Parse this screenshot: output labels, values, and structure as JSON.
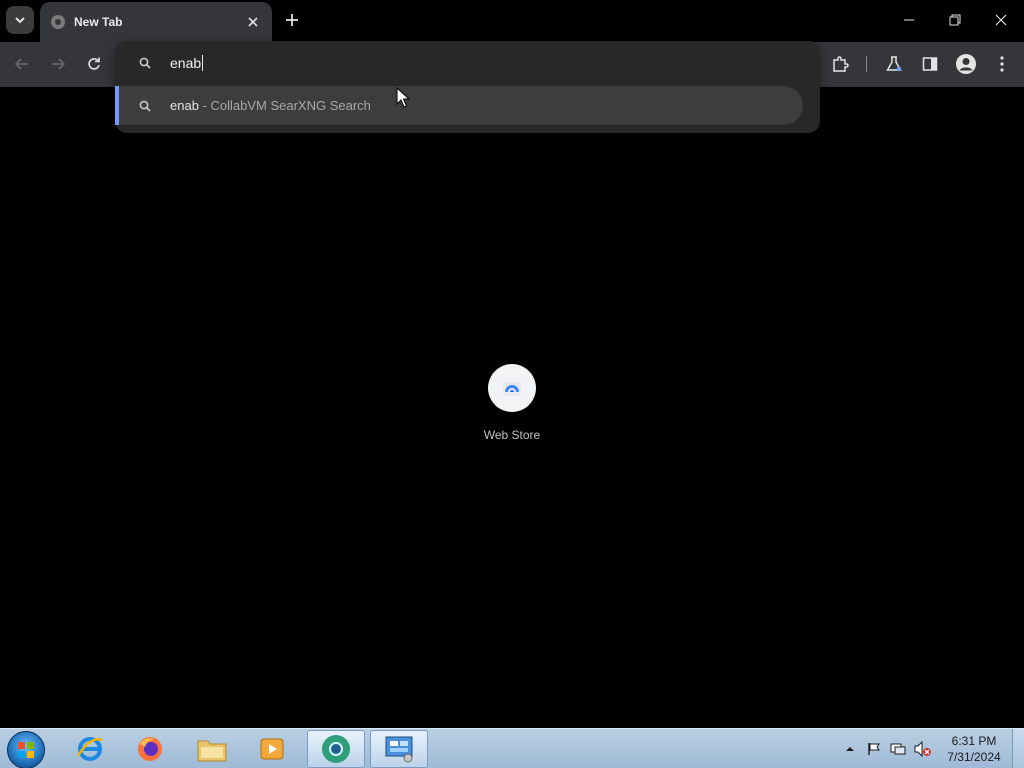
{
  "browser": {
    "tab": {
      "title": "New Tab"
    },
    "omnibox": {
      "input_value": "enab",
      "suggestion": {
        "query": "enab",
        "description": "- CollabVM SearXNG Search"
      }
    }
  },
  "page": {
    "shortcuts": [
      {
        "label": "Web Store"
      }
    ]
  },
  "taskbar": {
    "clock": {
      "time": "6:31 PM",
      "date": "7/31/2024"
    },
    "apps": [
      "internet-explorer",
      "firefox",
      "file-explorer",
      "media-player",
      "chrome",
      "control-panel"
    ]
  },
  "colors": {
    "accent": "#6c9dff",
    "toolbar": "#35363a",
    "popup": "#282828"
  }
}
